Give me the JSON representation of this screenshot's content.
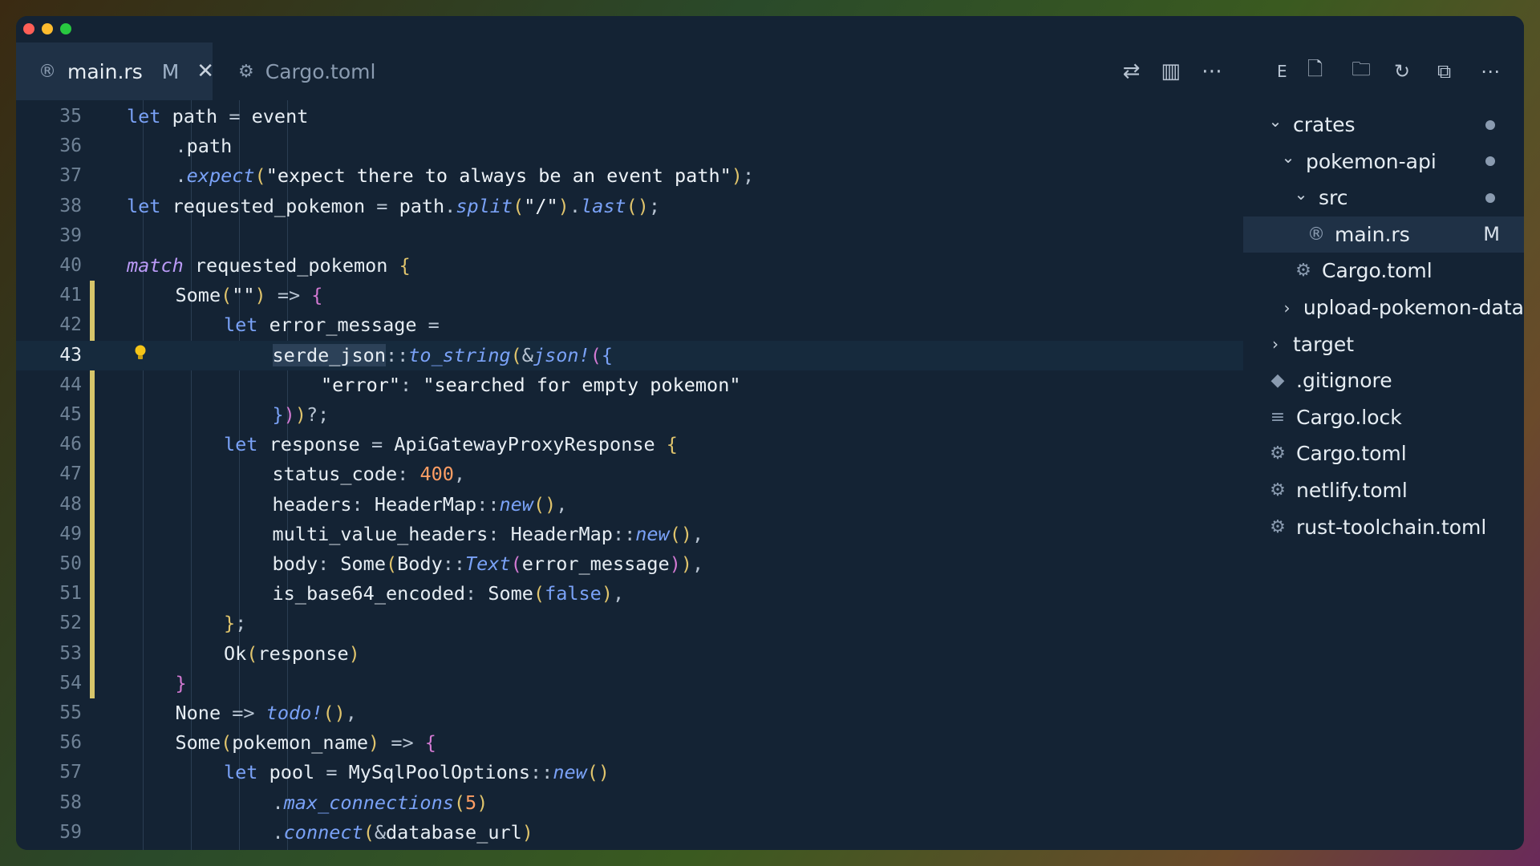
{
  "tabs": [
    {
      "label": "main.rs",
      "status": "M",
      "icon": "rust-icon",
      "active": true
    },
    {
      "label": "Cargo.toml",
      "icon": "gear-icon",
      "active": false
    }
  ],
  "tab_actions": [
    "source-control-compare-icon",
    "split-editor-icon",
    "more-actions-icon"
  ],
  "editor": {
    "current_line": 43,
    "lines": [
      {
        "n": "35",
        "indent": 1,
        "tokens": [
          [
            "kw",
            "let "
          ],
          [
            "id",
            "path "
          ],
          [
            "op",
            "= "
          ],
          [
            "id",
            "event"
          ]
        ]
      },
      {
        "n": "36",
        "indent": 2,
        "tokens": [
          [
            "op",
            "."
          ],
          [
            "id",
            "path"
          ]
        ]
      },
      {
        "n": "37",
        "indent": 2,
        "tokens": [
          [
            "op",
            "."
          ],
          [
            "fn",
            "expect"
          ],
          [
            "p1",
            "("
          ],
          [
            "str",
            "\"expect there to always be an event path\""
          ],
          [
            "p1",
            ")"
          ],
          [
            "op",
            ";"
          ]
        ]
      },
      {
        "n": "38",
        "indent": 1,
        "tokens": [
          [
            "kw",
            "let "
          ],
          [
            "id",
            "requested_pokemon "
          ],
          [
            "op",
            "= "
          ],
          [
            "id",
            "path"
          ],
          [
            "op",
            "."
          ],
          [
            "fn",
            "split"
          ],
          [
            "p1",
            "("
          ],
          [
            "str",
            "\"/\""
          ],
          [
            "p1",
            ")"
          ],
          [
            "op",
            "."
          ],
          [
            "fn",
            "last"
          ],
          [
            "p1",
            "()"
          ],
          [
            "op",
            ";"
          ]
        ]
      },
      {
        "n": "39",
        "indent": 0,
        "tokens": []
      },
      {
        "n": "40",
        "indent": 1,
        "tokens": [
          [
            "kwi",
            "match "
          ],
          [
            "id",
            "requested_pokemon "
          ],
          [
            "p1",
            "{"
          ]
        ]
      },
      {
        "n": "41",
        "indent": 2,
        "tokens": [
          [
            "id",
            "Some"
          ],
          [
            "p1",
            "("
          ],
          [
            "str",
            "\"\""
          ],
          [
            "p1",
            ") "
          ],
          [
            "op",
            "=> "
          ],
          [
            "p2",
            "{"
          ]
        ]
      },
      {
        "n": "42",
        "indent": 3,
        "tokens": [
          [
            "kw",
            "let "
          ],
          [
            "id",
            "error_message "
          ],
          [
            "op",
            "="
          ]
        ]
      },
      {
        "n": "43",
        "indent": 4,
        "tokens": [
          [
            "sel",
            "serde_json"
          ],
          [
            "op",
            "::"
          ],
          [
            "fn",
            "to_string"
          ],
          [
            "p1",
            "("
          ],
          [
            "op",
            "&"
          ],
          [
            "fn",
            "json!"
          ],
          [
            "p2",
            "("
          ],
          [
            "p3",
            "{"
          ]
        ]
      },
      {
        "n": "44",
        "indent": 5,
        "tokens": [
          [
            "str",
            "\"error\""
          ],
          [
            "op",
            ": "
          ],
          [
            "str",
            "\"searched for empty pokemon\""
          ]
        ]
      },
      {
        "n": "45",
        "indent": 4,
        "tokens": [
          [
            "p3",
            "}"
          ],
          [
            "p2",
            ")"
          ],
          [
            "p1",
            ")"
          ],
          [
            "op",
            "?;"
          ]
        ]
      },
      {
        "n": "46",
        "indent": 3,
        "tokens": [
          [
            "kw",
            "let "
          ],
          [
            "id",
            "response "
          ],
          [
            "op",
            "= "
          ],
          [
            "id",
            "ApiGatewayProxyResponse "
          ],
          [
            "p1",
            "{"
          ]
        ]
      },
      {
        "n": "47",
        "indent": 4,
        "tokens": [
          [
            "id",
            "status_code"
          ],
          [
            "op",
            ": "
          ],
          [
            "num",
            "400"
          ],
          [
            "op",
            ","
          ]
        ]
      },
      {
        "n": "48",
        "indent": 4,
        "tokens": [
          [
            "id",
            "headers"
          ],
          [
            "op",
            ": "
          ],
          [
            "id",
            "HeaderMap"
          ],
          [
            "op",
            "::"
          ],
          [
            "fn",
            "new"
          ],
          [
            "p1",
            "()"
          ],
          [
            "op",
            ","
          ]
        ]
      },
      {
        "n": "49",
        "indent": 4,
        "tokens": [
          [
            "id",
            "multi_value_headers"
          ],
          [
            "op",
            ": "
          ],
          [
            "id",
            "HeaderMap"
          ],
          [
            "op",
            "::"
          ],
          [
            "fn",
            "new"
          ],
          [
            "p1",
            "()"
          ],
          [
            "op",
            ","
          ]
        ]
      },
      {
        "n": "50",
        "indent": 4,
        "tokens": [
          [
            "id",
            "body"
          ],
          [
            "op",
            ": "
          ],
          [
            "id",
            "Some"
          ],
          [
            "p1",
            "("
          ],
          [
            "id",
            "Body"
          ],
          [
            "op",
            "::"
          ],
          [
            "fn",
            "Text"
          ],
          [
            "p2",
            "("
          ],
          [
            "id",
            "error_message"
          ],
          [
            "p2",
            ")"
          ],
          [
            "p1",
            ")"
          ],
          [
            "op",
            ","
          ]
        ]
      },
      {
        "n": "51",
        "indent": 4,
        "tokens": [
          [
            "id",
            "is_base64_encoded"
          ],
          [
            "op",
            ": "
          ],
          [
            "id",
            "Some"
          ],
          [
            "p1",
            "("
          ],
          [
            "kw",
            "false"
          ],
          [
            "p1",
            ")"
          ],
          [
            "op",
            ","
          ]
        ]
      },
      {
        "n": "52",
        "indent": 3,
        "tokens": [
          [
            "p1",
            "}"
          ],
          [
            "op",
            ";"
          ]
        ]
      },
      {
        "n": "53",
        "indent": 3,
        "tokens": [
          [
            "id",
            "Ok"
          ],
          [
            "p1",
            "("
          ],
          [
            "id",
            "response"
          ],
          [
            "p1",
            ")"
          ]
        ]
      },
      {
        "n": "54",
        "indent": 2,
        "tokens": [
          [
            "p2",
            "}"
          ]
        ]
      },
      {
        "n": "55",
        "indent": 2,
        "tokens": [
          [
            "id",
            "None "
          ],
          [
            "op",
            "=> "
          ],
          [
            "fn",
            "todo!"
          ],
          [
            "p1",
            "()"
          ],
          [
            "op",
            ","
          ]
        ]
      },
      {
        "n": "56",
        "indent": 2,
        "tokens": [
          [
            "id",
            "Some"
          ],
          [
            "p1",
            "("
          ],
          [
            "id",
            "pokemon_name"
          ],
          [
            "p1",
            ") "
          ],
          [
            "op",
            "=> "
          ],
          [
            "p2",
            "{"
          ]
        ]
      },
      {
        "n": "57",
        "indent": 3,
        "tokens": [
          [
            "kw",
            "let "
          ],
          [
            "id",
            "pool "
          ],
          [
            "op",
            "= "
          ],
          [
            "id",
            "MySqlPoolOptions"
          ],
          [
            "op",
            "::"
          ],
          [
            "fn",
            "new"
          ],
          [
            "p1",
            "()"
          ]
        ]
      },
      {
        "n": "58",
        "indent": 4,
        "tokens": [
          [
            "op",
            "."
          ],
          [
            "fn",
            "max_connections"
          ],
          [
            "p1",
            "("
          ],
          [
            "num",
            "5"
          ],
          [
            "p1",
            ")"
          ]
        ]
      },
      {
        "n": "59",
        "indent": 4,
        "tokens": [
          [
            "op",
            "."
          ],
          [
            "fn",
            "connect"
          ],
          [
            "p1",
            "("
          ],
          [
            "op",
            "&"
          ],
          [
            "id",
            "database_url"
          ],
          [
            "p1",
            ")"
          ]
        ]
      }
    ]
  },
  "explorer": {
    "header_letter": "E",
    "actions": [
      "new-file-icon",
      "new-folder-icon",
      "refresh-icon",
      "collapse-all-icon",
      "more-actions-icon"
    ],
    "items": [
      {
        "label": "crates",
        "depth": 0,
        "kind": "folder-open",
        "badge": "dot"
      },
      {
        "label": "pokemon-api",
        "depth": 1,
        "kind": "folder-open",
        "badge": "dot"
      },
      {
        "label": "src",
        "depth": 2,
        "kind": "folder-open",
        "badge": "dot"
      },
      {
        "label": "main.rs",
        "depth": 3,
        "kind": "rust-file",
        "badge": "M",
        "selected": true
      },
      {
        "label": "Cargo.toml",
        "depth": 2,
        "kind": "gear-file"
      },
      {
        "label": "upload-pokemon-data",
        "depth": 1,
        "kind": "folder-closed"
      },
      {
        "label": "target",
        "depth": 0,
        "kind": "folder-closed"
      },
      {
        "label": ".gitignore",
        "depth": 0,
        "kind": "git-file"
      },
      {
        "label": "Cargo.lock",
        "depth": 0,
        "kind": "lines-file"
      },
      {
        "label": "Cargo.toml",
        "depth": 0,
        "kind": "gear-file"
      },
      {
        "label": "netlify.toml",
        "depth": 0,
        "kind": "gear-file"
      },
      {
        "label": "rust-toolchain.toml",
        "depth": 0,
        "kind": "gear-file"
      }
    ]
  },
  "colors": {
    "kw": "#7aa2f7",
    "kwi": "#bb9af7",
    "id": "#e6edf3",
    "fn": "#7aa2f7",
    "str": "#eef3f8",
    "num": "#ff9e64",
    "op": "#b8c4d2",
    "p1": "#e0c46c",
    "p2": "#d279d2",
    "p3": "#7aa2f7",
    "sel": "#e6edf3",
    "modified_bar": "#d7c56a"
  }
}
